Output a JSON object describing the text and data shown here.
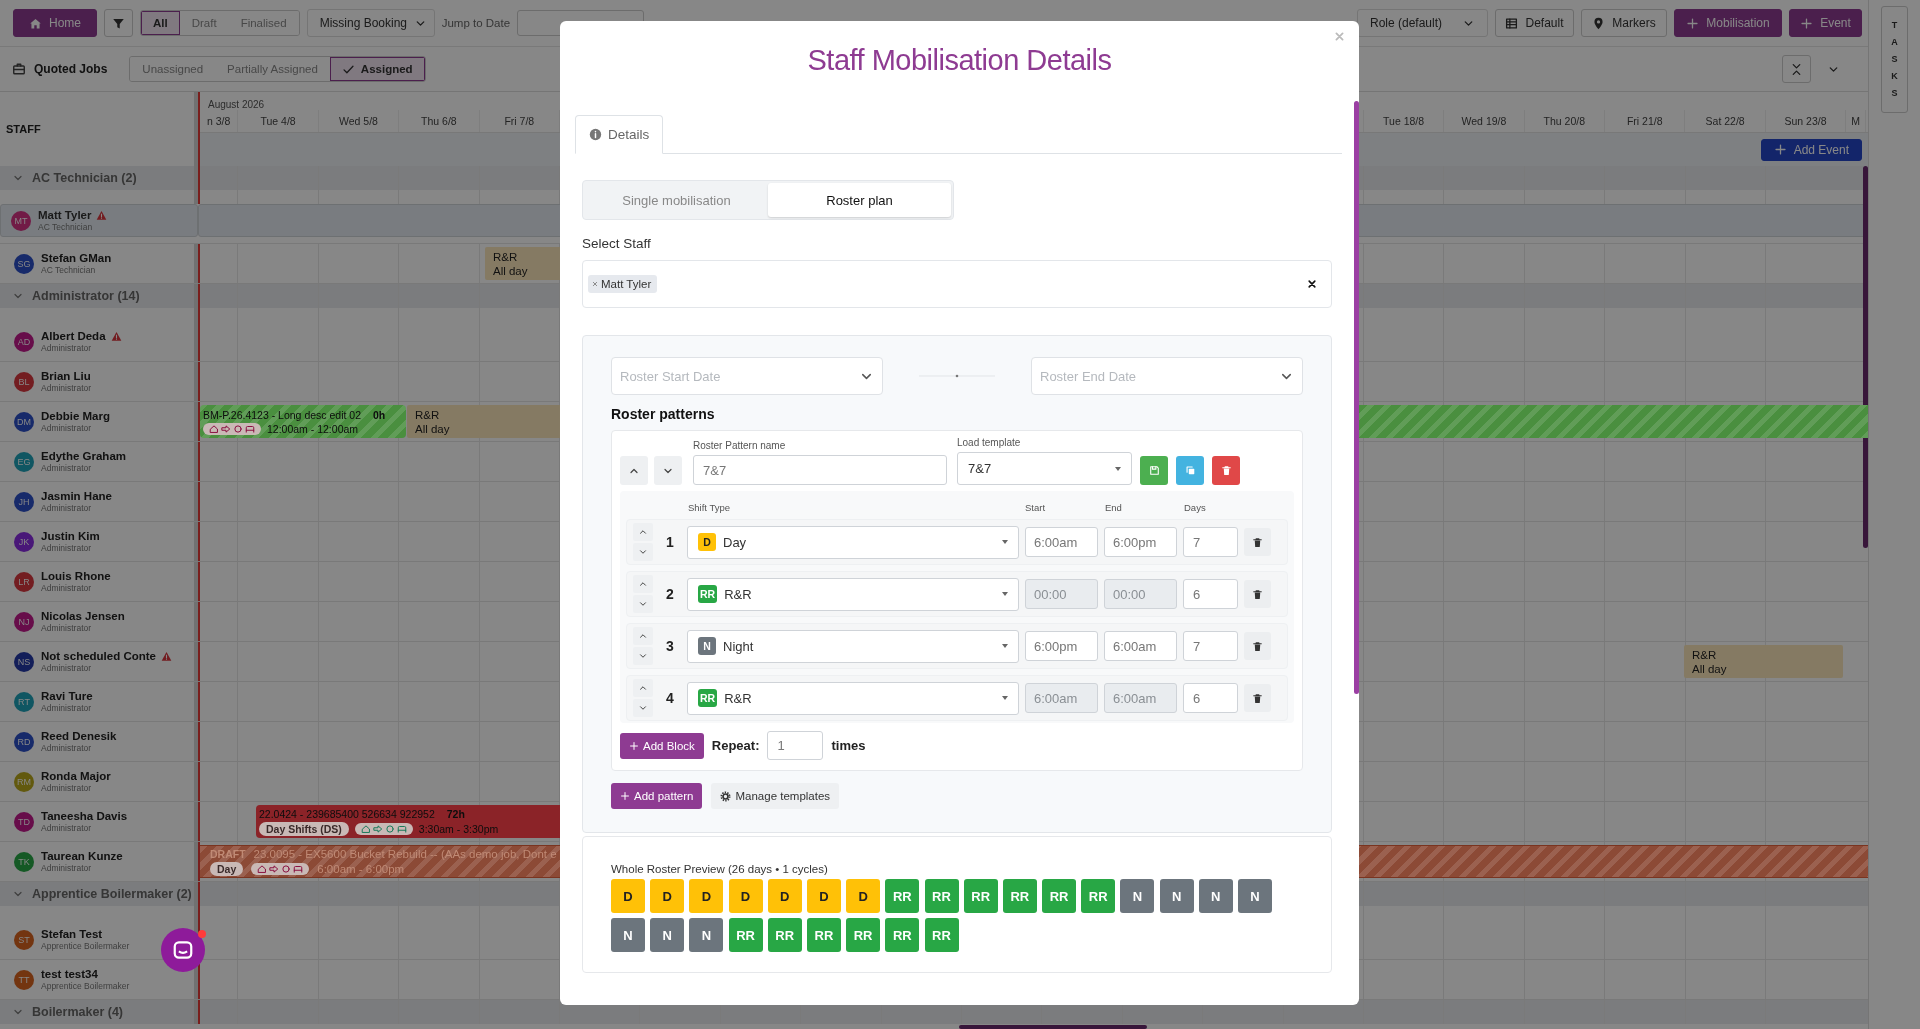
{
  "toolbar": {
    "home": "Home",
    "status_filters": [
      {
        "label": "All",
        "selected": true
      },
      {
        "label": "Draft",
        "selected": false
      },
      {
        "label": "Finalised",
        "selected": false
      }
    ],
    "booking_filter": "Missing Booking",
    "jump_label": "Jump to Date",
    "organise": "Role (default)",
    "layout": "Default",
    "markers": "Markers",
    "actions": [
      "Mobilisation",
      "Event"
    ]
  },
  "tasks_tab": "TASKS",
  "quoted_jobs": "Quoted Jobs",
  "assignment_filters": [
    {
      "label": "Unassigned",
      "selected": false
    },
    {
      "label": "Partially Assigned",
      "selected": false
    },
    {
      "label": "Assigned",
      "selected": true
    }
  ],
  "calendar": {
    "staff_heading": "STAFF",
    "month": "August 2026",
    "days_left": [
      "n 3/8",
      "Tue 4/8",
      "Wed 5/8",
      "Thu 6/8",
      "Fri 7/8"
    ],
    "days_right": [
      "Tue 18/8",
      "Wed 19/8",
      "Thu 20/8",
      "Fri 21/8",
      "Sat 22/8",
      "Sun 23/8",
      "M"
    ],
    "add_event": "Add Event",
    "groups": [
      {
        "name": "AC Technician (2)",
        "expanded": true,
        "members": [
          {
            "name": "Matt Tyler",
            "role": "AC Technician",
            "initials": "MT",
            "color": "#711b46",
            "warning": true,
            "selected": true
          },
          {
            "name": "Stefan GMan",
            "role": "AC Technician",
            "initials": "SG",
            "color": "#172a6a",
            "warning": false,
            "selected": false,
            "events": [
              {
                "kind": "leave",
                "title": "R&R",
                "subtitle": "All day",
                "color": "#857a63"
              }
            ]
          }
        ]
      },
      {
        "name": "Administrator (14)",
        "expanded": true,
        "members": [
          {
            "name": "Albert Deda",
            "role": "Administrator",
            "initials": "AD",
            "color": "#670d4a",
            "warning": true,
            "selected": false
          },
          {
            "name": "Brian Liu",
            "role": "Administrator",
            "initials": "BL",
            "color": "#731d21",
            "warning": false,
            "selected": false
          },
          {
            "name": "Debbie Marg",
            "role": "Administrator",
            "initials": "DM",
            "color": "#172a6a",
            "warning": false,
            "selected": false,
            "events": [
              {
                "kind": "job",
                "title": "BM-P.26.4123 - Long desc edit 02",
                "hours": "0h",
                "time": "12:00am - 12:00am",
                "color": "#4a8f3f",
                "striped": true
              },
              {
                "kind": "leave",
                "title": "R&R",
                "subtitle": "All day",
                "color": "#857a63"
              },
              {
                "kind": "job",
                "color": "#4a8f3f",
                "striped": true
              }
            ]
          },
          {
            "name": "Edythe Graham",
            "role": "Administrator",
            "initials": "EG",
            "color": "#105662",
            "warning": false,
            "selected": false
          },
          {
            "name": "Jasmin Hane",
            "role": "Administrator",
            "initials": "JH",
            "color": "#172a6a",
            "warning": false,
            "selected": false
          },
          {
            "name": "Justin Kim",
            "role": "Administrator",
            "initials": "JK",
            "color": "#491778",
            "warning": false,
            "selected": false
          },
          {
            "name": "Louis Rhone",
            "role": "Administrator",
            "initials": "LR",
            "color": "#731d21",
            "warning": false,
            "selected": false
          },
          {
            "name": "Nicolas Jensen",
            "role": "Administrator",
            "initials": "NJ",
            "color": "#670d4a",
            "warning": false,
            "selected": false
          },
          {
            "name": "Not scheduled Conte",
            "role": "Administrator",
            "initials": "NS",
            "color": "#131e59",
            "warning": true,
            "selected": false,
            "events": [
              {
                "kind": "leave",
                "title": "R&R",
                "subtitle": "All day",
                "color": "#857a63"
              }
            ]
          },
          {
            "name": "Ravi Ture",
            "role": "Administrator",
            "initials": "RT",
            "color": "#105662",
            "warning": false,
            "selected": false
          },
          {
            "name": "Reed Denesik",
            "role": "Administrator",
            "initials": "RD",
            "color": "#172a6a",
            "warning": false,
            "selected": false
          },
          {
            "name": "Ronda Major",
            "role": "Administrator",
            "initials": "RM",
            "color": "#62590e",
            "warning": false,
            "selected": false
          },
          {
            "name": "Taneesha Davis",
            "role": "Administrator",
            "initials": "TD",
            "color": "#670d4a",
            "warning": false,
            "selected": false,
            "events": [
              {
                "kind": "job",
                "title": "22.0424 - 239685400 526634 922952",
                "hours": "72h",
                "pill": "Day Shifts (DS)",
                "time": "3:30am - 3:30pm",
                "color": "#8b2328",
                "striped": false
              }
            ]
          },
          {
            "name": "Taurean Kunze",
            "role": "Administrator",
            "initials": "TK",
            "color": "#155925",
            "warning": false,
            "selected": false,
            "events": [
              {
                "kind": "draft",
                "label": "DRAFT",
                "title": "23.0095 - EX5600 Bucket Rebuild -- (AAs demo job, Dont e",
                "pill": "Day",
                "time": "6:00am - 6:00pm",
                "color": "#8c4a36",
                "striped": true
              }
            ]
          }
        ]
      },
      {
        "name": "Apprentice Boilermaker (2)",
        "expanded": true,
        "members": [
          {
            "name": "Stefan Test",
            "role": "Apprentice Boilermaker",
            "initials": "ST",
            "color": "#733510",
            "warning": false,
            "selected": false
          },
          {
            "name": "test test34",
            "role": "Apprentice Boilermaker",
            "initials": "TT",
            "color": "#733510",
            "warning": false,
            "selected": false
          }
        ]
      },
      {
        "name": "Boilermaker (4)",
        "expanded": true
      }
    ]
  },
  "modal": {
    "title": "Staff Mobilisation Details",
    "tabs": [
      {
        "label": "Details",
        "selected": true
      }
    ],
    "modes": [
      {
        "label": "Single mobilisation",
        "selected": false
      },
      {
        "label": "Roster plan",
        "selected": true
      }
    ],
    "staff_label": "Select Staff",
    "staff": [
      {
        "name": "Matt Tyler"
      }
    ],
    "start_placeholder": "Roster Start Date",
    "end_placeholder": "Roster End Date",
    "patterns_heading": "Roster patterns",
    "patterns": [
      {
        "name_label": "Roster Pattern name",
        "name": "7&7",
        "template_label": "Load template",
        "template": "7&7",
        "columns": [
          "Shift Type",
          "Start",
          "End",
          "Days"
        ],
        "blocks": [
          {
            "number": "1",
            "code": "D",
            "color": "#ffc107",
            "shift": "Day",
            "start": "6:00am",
            "end": "6:00pm",
            "days": "7",
            "times_disabled": false
          },
          {
            "number": "2",
            "code": "RR",
            "color": "#28a745",
            "shift": "R&R",
            "start": "00:00",
            "end": "00:00",
            "days": "6",
            "times_disabled": true
          },
          {
            "number": "3",
            "code": "N",
            "color": "#6c757d",
            "shift": "Night",
            "start": "6:00pm",
            "end": "6:00am",
            "days": "7",
            "times_disabled": false
          },
          {
            "number": "4",
            "code": "RR",
            "color": "#28a745",
            "shift": "R&R",
            "start": "6:00am",
            "end": "6:00am",
            "days": "6",
            "times_disabled": true
          }
        ],
        "add_block": "Add Block",
        "repeat_label": "Repeat:",
        "repeat": "1",
        "times": "times"
      }
    ],
    "add_pattern": "Add pattern",
    "manage_templates": "Manage templates",
    "preview": {
      "title": "Whole Roster Preview (26 days • 1 cycles)",
      "days": [
        {
          "code": "D",
          "color": "#ffc107"
        },
        {
          "code": "D",
          "color": "#ffc107"
        },
        {
          "code": "D",
          "color": "#ffc107"
        },
        {
          "code": "D",
          "color": "#ffc107"
        },
        {
          "code": "D",
          "color": "#ffc107"
        },
        {
          "code": "D",
          "color": "#ffc107"
        },
        {
          "code": "D",
          "color": "#ffc107"
        },
        {
          "code": "RR",
          "color": "#28a745"
        },
        {
          "code": "RR",
          "color": "#28a745"
        },
        {
          "code": "RR",
          "color": "#28a745"
        },
        {
          "code": "RR",
          "color": "#28a745"
        },
        {
          "code": "RR",
          "color": "#28a745"
        },
        {
          "code": "RR",
          "color": "#28a745"
        },
        {
          "code": "N",
          "color": "#6c757d"
        },
        {
          "code": "N",
          "color": "#6c757d"
        },
        {
          "code": "N",
          "color": "#6c757d"
        },
        {
          "code": "N",
          "color": "#6c757d"
        },
        {
          "code": "N",
          "color": "#6c757d"
        },
        {
          "code": "N",
          "color": "#6c757d"
        },
        {
          "code": "N",
          "color": "#6c757d"
        },
        {
          "code": "RR",
          "color": "#28a745"
        },
        {
          "code": "RR",
          "color": "#28a745"
        },
        {
          "code": "RR",
          "color": "#28a745"
        },
        {
          "code": "RR",
          "color": "#28a745"
        },
        {
          "code": "RR",
          "color": "#28a745"
        },
        {
          "code": "RR",
          "color": "#28a745"
        }
      ]
    }
  }
}
